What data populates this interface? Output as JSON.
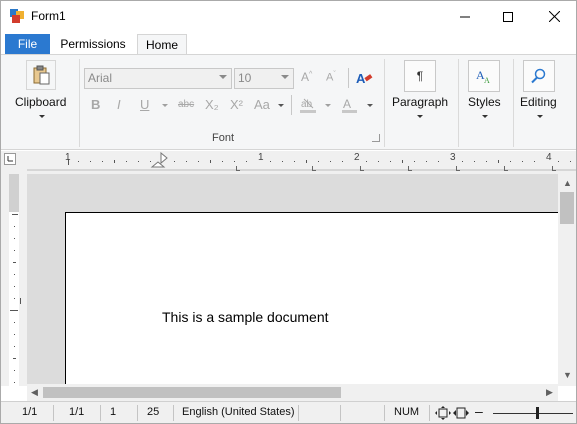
{
  "window": {
    "title": "Form1"
  },
  "titlebar_buttons": {
    "minimize": "minimize",
    "maximize": "maximize",
    "close": "close"
  },
  "tabs": [
    {
      "label": "File",
      "active": false
    },
    {
      "label": "Permissions",
      "active": false
    },
    {
      "label": "Home",
      "active": true
    }
  ],
  "ribbon": {
    "clipboard": {
      "label": "Clipboard"
    },
    "font": {
      "label": "Font",
      "family": "Arial",
      "size": "10",
      "format_buttons": [
        "B",
        "I",
        "U",
        "abc",
        "X₂",
        "X²",
        "Aa"
      ]
    },
    "paragraph": {
      "label": "Paragraph"
    },
    "styles": {
      "label": "Styles"
    },
    "editing": {
      "label": "Editing"
    }
  },
  "ruler": {
    "numbers": [
      "1",
      "1",
      "2",
      "3",
      "4"
    ]
  },
  "document": {
    "text": "This is a sample document"
  },
  "statusbar": {
    "page": "1/1",
    "section": "1/1",
    "line": "1",
    "column": "25",
    "language": "English (United States)",
    "num_lock": "NUM"
  },
  "colors": {
    "file_tab": "#2b79d0",
    "ribbon_bg": "#f5f6f7",
    "canvas_bg": "#dcdcdc"
  }
}
